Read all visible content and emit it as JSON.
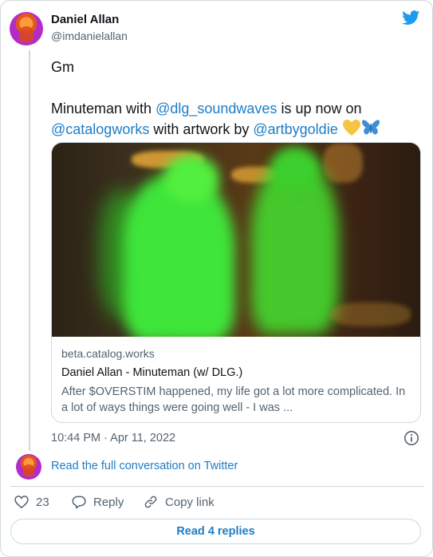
{
  "author": {
    "name": "Daniel Allan",
    "handle": "@imdanielallan"
  },
  "tweet": {
    "line1": "Gm",
    "line2_prefix": "Minuteman with ",
    "mention1": "@dlg_soundwaves",
    "line2_suffix": " is up now on",
    "mention2": "@catalogworks",
    "line3_middle": " with artwork by ",
    "mention3": "@artbygoldie",
    "emoji_heart": "💛",
    "emoji_butterfly": "🦋"
  },
  "link_card": {
    "domain": "beta.catalog.works",
    "title": "Daniel Allan - Minuteman (w/ DLG.)",
    "description": "After $OVERSTIM happened, my life got a lot more complicated. In a lot of ways things were going well - I was ..."
  },
  "meta": {
    "timestamp": "10:44 PM · Apr 11, 2022"
  },
  "conversation": {
    "link_text": "Read the full conversation on Twitter"
  },
  "actions": {
    "like_count": "23",
    "reply_label": "Reply",
    "copy_label": "Copy link"
  },
  "read_replies_label": "Read 4 replies",
  "colors": {
    "accent": "#1d7dc6",
    "twitter_blue": "#1d9bf0",
    "secondary_text": "#536471",
    "border": "#cfd9de"
  },
  "icons": {
    "brand": "twitter-bird-icon",
    "info": "info-icon",
    "like": "heart-icon",
    "reply": "speech-bubble-icon",
    "copy": "link-icon"
  }
}
